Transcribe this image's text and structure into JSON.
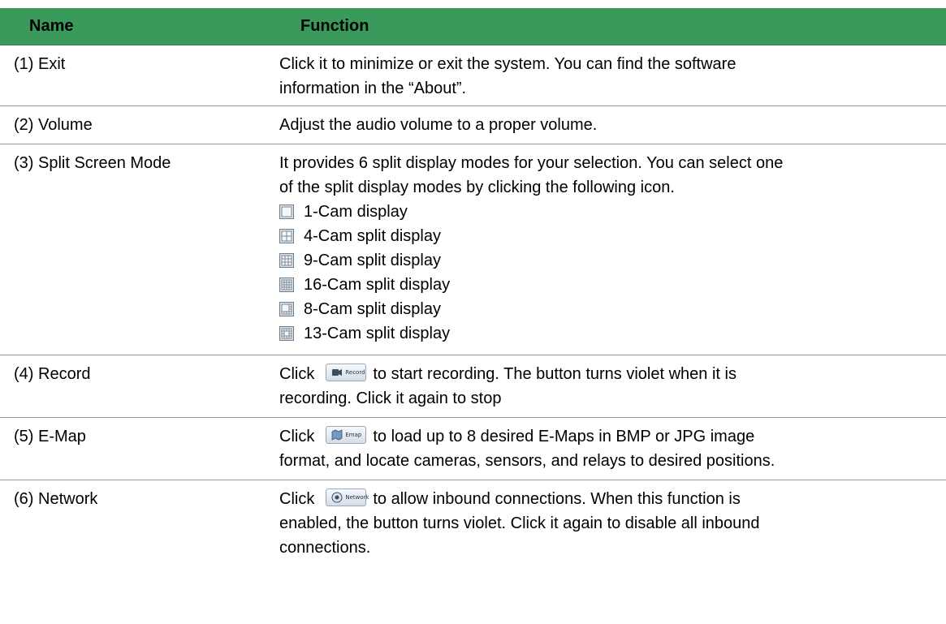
{
  "header": {
    "name_label": "Name",
    "function_label": "Function"
  },
  "rows": [
    {
      "name": "(1) Exit",
      "lines": [
        "Click it to minimize or exit the system. You can find the software",
        "information in the “About”."
      ]
    },
    {
      "name": "(2) Volume",
      "lines": [
        "Adjust the audio volume to a proper volume."
      ]
    },
    {
      "name": "(3) Split Screen Mode",
      "lines": [
        "It provides 6 split display modes for your selection. You can select one",
        "of the split display modes by clicking the following icon."
      ],
      "modes": [
        {
          "icon": "1-cam-icon",
          "label": "1-Cam display"
        },
        {
          "icon": "4-cam-icon",
          "label": "4-Cam split display"
        },
        {
          "icon": "9-cam-icon",
          "label": "9-Cam split display"
        },
        {
          "icon": "16-cam-icon",
          "label": "16-Cam split display"
        },
        {
          "icon": "8-cam-icon",
          "label": "8-Cam split display"
        },
        {
          "icon": "13-cam-icon",
          "label": "13-Cam split display"
        }
      ]
    },
    {
      "name": "(4) Record",
      "click_word": "Click",
      "button_text": "Record",
      "first_line_rest": "to start recording. The button turns violet when it is",
      "lines": [
        "recording. Click it again to stop"
      ]
    },
    {
      "name": "(5) E-Map",
      "click_word": "Click",
      "button_text": "Emap",
      "first_line_rest": "to load up to 8 desired E-Maps in BMP or JPG image",
      "lines": [
        "format, and locate cameras, sensors, and relays to desired positions."
      ]
    },
    {
      "name": "(6) Network",
      "click_word": "Click",
      "button_text": "Network",
      "first_line_rest": "to allow inbound connections. When this function is",
      "lines": [
        "enabled, the button turns violet. Click it again to disable all inbound",
        "connections."
      ]
    }
  ]
}
